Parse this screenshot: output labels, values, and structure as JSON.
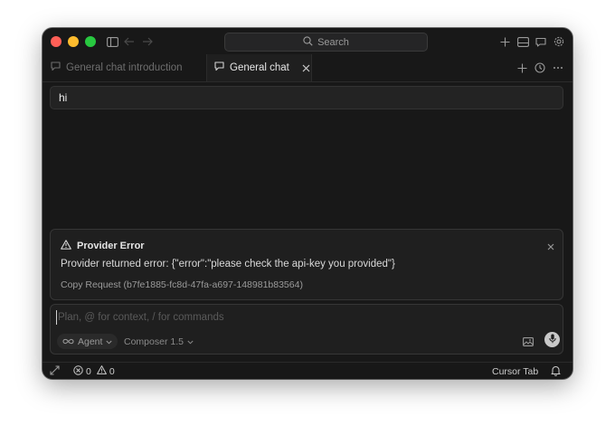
{
  "titlebar": {
    "search_label": "Search",
    "icons": [
      "sidebar-toggle-icon",
      "arrow-left-icon",
      "arrow-right-icon",
      "search-icon",
      "plus-icon",
      "panel-icon",
      "chat-icon",
      "gear-icon"
    ]
  },
  "tabs": [
    {
      "label": "General chat introduction",
      "active": false,
      "icon": "chat-bubble-icon"
    },
    {
      "label": "General chat",
      "active": true,
      "icon": "chat-bubble-icon"
    }
  ],
  "tabbar_actions": [
    "plus-icon",
    "history-icon",
    "more-icon"
  ],
  "message": {
    "text": "hi"
  },
  "error": {
    "title": "Provider Error",
    "message": "Provider returned error: {\"error\":\"please check the api-key you provided\"}",
    "copy_request": "Copy Request (b7fe1885-fc8d-47fa-a697-148981b83564)"
  },
  "composer": {
    "placeholder": "Plan, @ for context, / for commands",
    "mode_label": "Agent",
    "model_label": "Composer 1.5"
  },
  "statusbar": {
    "errors": "0",
    "warnings": "0",
    "cursor_tab": "Cursor Tab"
  },
  "colors": {
    "background": "#181818",
    "traffic_red": "#ff5f57",
    "traffic_yellow": "#febc2e",
    "traffic_green": "#28c840"
  }
}
